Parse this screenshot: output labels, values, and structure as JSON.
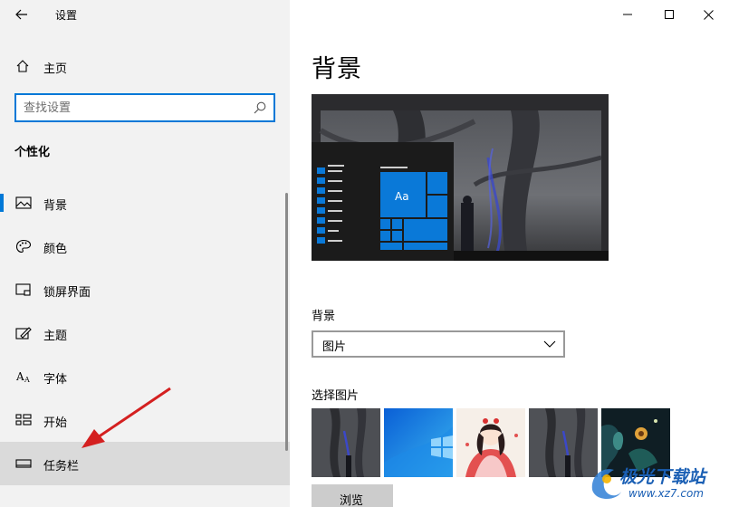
{
  "window": {
    "title": "设置"
  },
  "sidebar": {
    "home_label": "主页",
    "search_placeholder": "查找设置",
    "section_title": "个性化",
    "items": [
      {
        "label": "背景",
        "icon": "picture-icon",
        "selected": true
      },
      {
        "label": "颜色",
        "icon": "palette-icon"
      },
      {
        "label": "锁屏界面",
        "icon": "lock-screen-icon"
      },
      {
        "label": "主题",
        "icon": "theme-icon"
      },
      {
        "label": "字体",
        "icon": "font-icon"
      },
      {
        "label": "开始",
        "icon": "start-grid-icon"
      },
      {
        "label": "任务栏",
        "icon": "taskbar-icon",
        "hover": true
      }
    ]
  },
  "main": {
    "title": "背景",
    "preview": {
      "tile_text": "Aa"
    },
    "background_label": "背景",
    "background_value": "图片",
    "choose_picture_label": "选择图片",
    "thumbnails": [
      "forest-night",
      "windows-blue",
      "anime-girl",
      "forest-night-2",
      "dark-teal-flower"
    ],
    "browse_label": "浏览"
  },
  "watermark": {
    "text": "极光下载站",
    "url": "www.xz7.com"
  },
  "colors": {
    "accent": "#0078d7",
    "sidebar_bg": "#f2f2f2",
    "hover_bg": "#dadada",
    "arrow_red": "#d42020"
  }
}
